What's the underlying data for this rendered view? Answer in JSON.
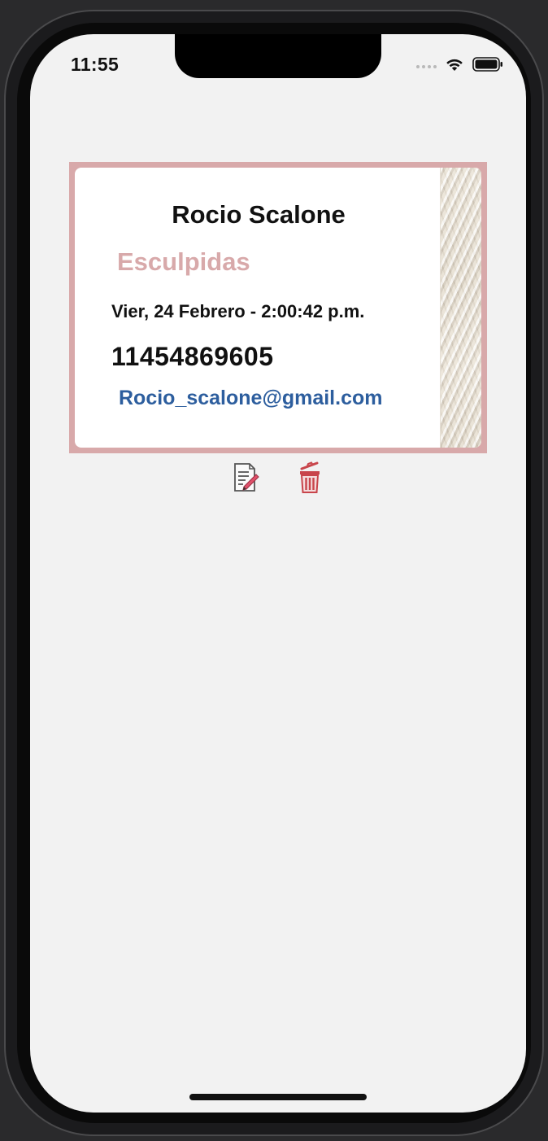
{
  "status_bar": {
    "time": "11:55"
  },
  "appointment_card": {
    "client_name": "Rocio Scalone",
    "service": "Esculpidas",
    "datetime": "Vier, 24 Febrero - 2:00:42 p.m.",
    "phone": "11454869605",
    "email": "Rocio_scalone@gmail.com"
  },
  "actions": {
    "edit_icon": "edit-document-icon",
    "delete_icon": "trash-icon"
  },
  "colors": {
    "accent_pink": "#d8a9aa",
    "email_blue": "#2d5e9e",
    "delete_red": "#c8454b",
    "background": "#f2f2f2"
  }
}
